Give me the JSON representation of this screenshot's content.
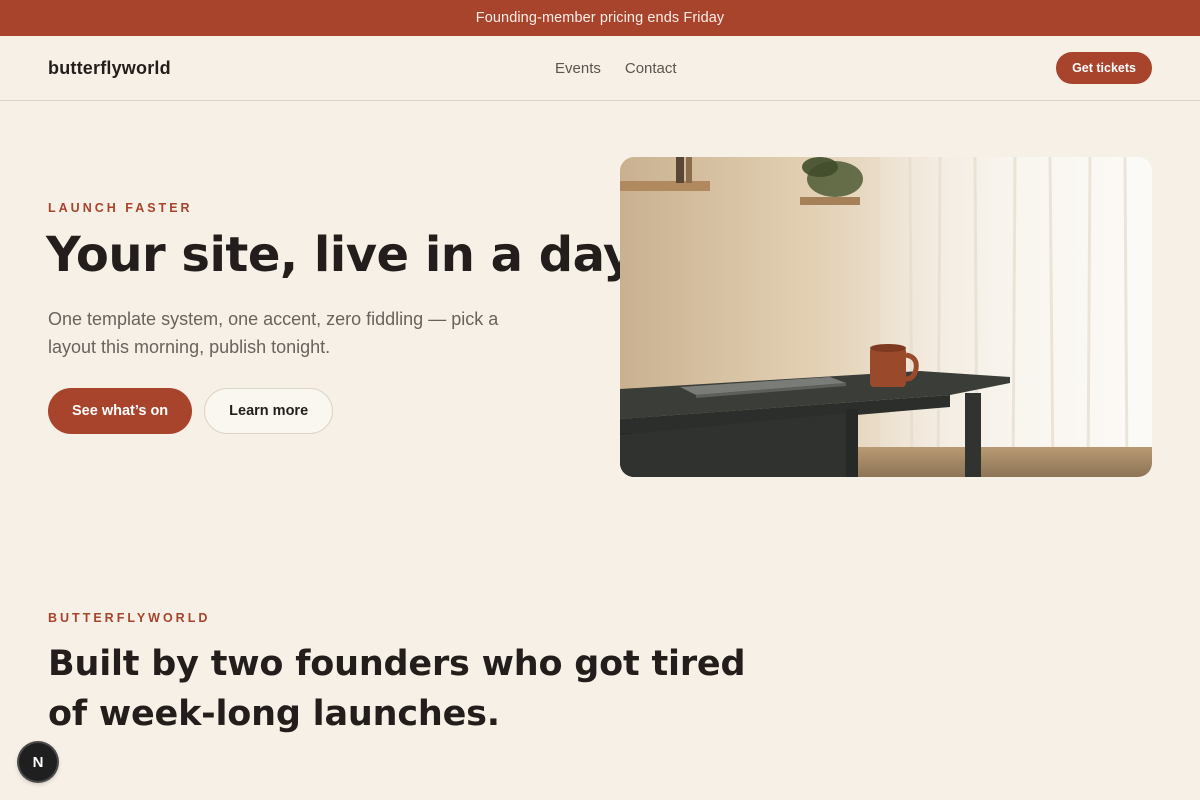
{
  "announcement": {
    "text": "Founding-member pricing ends Friday"
  },
  "nav": {
    "logo": "butterflyworld",
    "links": [
      {
        "label": "Events"
      },
      {
        "label": "Contact"
      }
    ],
    "cta_label": "Get tickets"
  },
  "hero": {
    "eyebrow": "LAUNCH FASTER",
    "title": "Your site, live in a day",
    "subtitle": "One template system, one accent, zero fiddling — pick a layout this morning, publish tonight.",
    "primary_cta": "See what’s on",
    "secondary_cta": "Learn more",
    "image_alt": "Dark wooden desk with a terracotta mug and closed laptop beside sheer curtains"
  },
  "about": {
    "eyebrow": "BUTTERFLYWORLD",
    "title": "Built by two founders who got tired of week-long launches."
  },
  "badge": {
    "label": "N"
  },
  "colors": {
    "accent": "#a8432c",
    "background": "#f7f0e6",
    "text": "#231e1b"
  }
}
